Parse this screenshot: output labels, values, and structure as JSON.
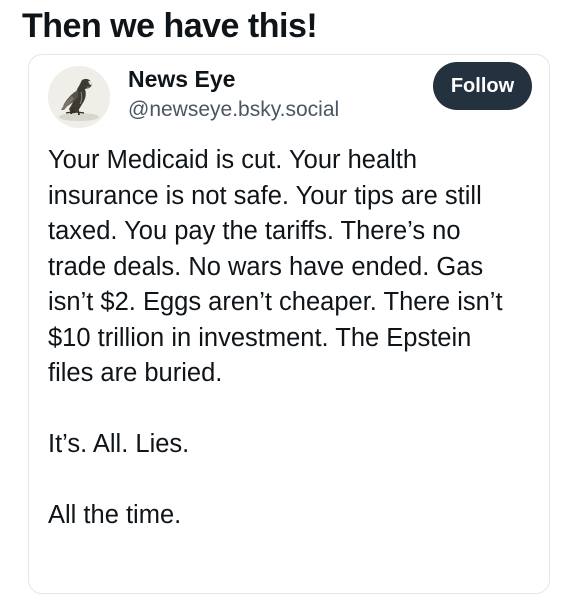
{
  "headline": "Then we have this!",
  "post": {
    "author_name": "News Eye",
    "author_handle": "@newseye.bsky.social",
    "follow_label": "Follow",
    "paragraphs": [
      "Your Medicaid is cut. Your health insurance is not safe. Your tips are still taxed. You pay the tariffs. There’s no trade deals. No wars have ended. Gas isn’t $2. Eggs aren’t cheaper. There isn’t $10 trillion in investment. The Epstein files are buried.",
      "It’s. All. Lies.",
      "All the time."
    ]
  },
  "colors": {
    "follow_button_bg": "#24323f",
    "card_border": "#e2e5e9",
    "handle_text": "#4b5563"
  },
  "icons": {
    "avatar": "eagle-sketch-avatar"
  }
}
